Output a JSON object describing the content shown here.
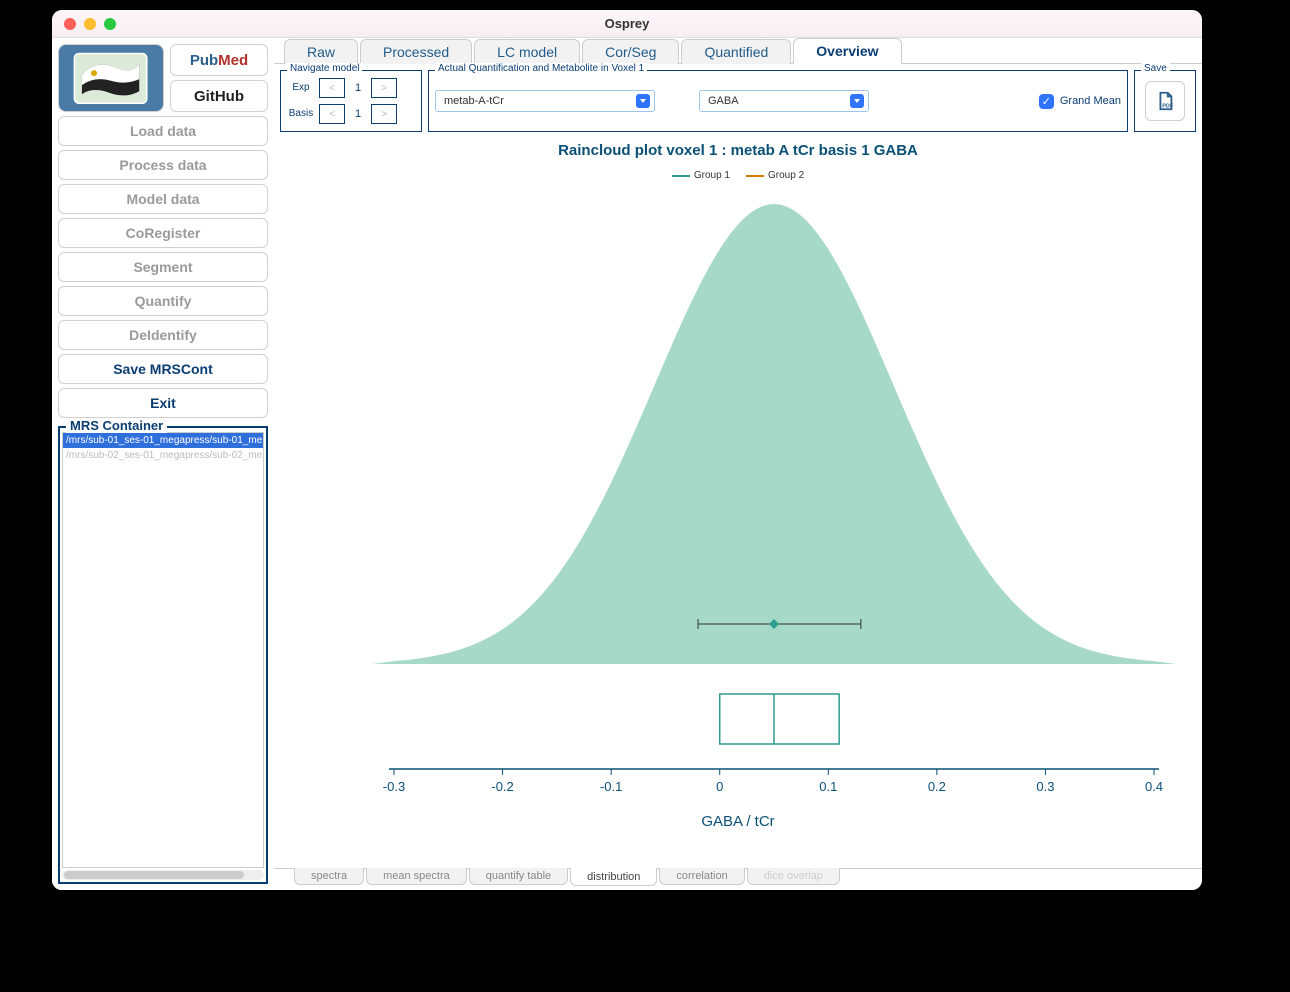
{
  "window": {
    "title": "Osprey"
  },
  "links": {
    "pubmed": "PubMed",
    "github": "GitHub"
  },
  "sidebar": {
    "buttons": [
      "Load data",
      "Process data",
      "Model data",
      "CoRegister",
      "Segment",
      "Quantify",
      "DeIdentify",
      "Save MRSCont",
      "Exit"
    ],
    "container_title": "MRS Container",
    "items": [
      "/mrs/sub-01_ses-01_megapress/sub-01_me...",
      "/mrs/sub-02_ses-01_megapress/sub-02_me..."
    ],
    "selected_index": 0
  },
  "tabs_top": [
    "Raw",
    "Processed",
    "LC model",
    "Cor/Seg",
    "Quantified",
    "Overview"
  ],
  "tabs_top_active": 5,
  "nav_model": {
    "legend": "Navigate model",
    "rows": [
      {
        "label": "Exp",
        "value": "1"
      },
      {
        "label": "Basis",
        "value": "1"
      }
    ],
    "prev": "<",
    "next": ">"
  },
  "quant": {
    "legend": "Actual Quantification and Metabolite in Voxel 1",
    "select1": "metab-A-tCr",
    "select2": "GABA",
    "check_label": "Grand Mean",
    "checked": true
  },
  "save": {
    "legend": "Save",
    "pdf": "PDF"
  },
  "plot": {
    "title": "Raincloud plot voxel 1 : metab A tCr basis 1 GABA",
    "legend": [
      "Group 1",
      "Group 2"
    ],
    "xlabel": "GABA / tCr"
  },
  "chart_data": {
    "type": "raincloud",
    "xlabel": "GABA / tCr",
    "x_ticks": [
      -0.3,
      -0.2,
      -0.1,
      0,
      0.1,
      0.2,
      0.3,
      0.4
    ],
    "xlim": [
      -0.3,
      0.4
    ],
    "series": [
      {
        "name": "Group 1",
        "color": "#2d9c8d"
      },
      {
        "name": "Group 2",
        "color": "#d57a00"
      }
    ],
    "density_fill": "#a6d9c7",
    "density_peak_x": 0.05,
    "mean_marker_x": 0.05,
    "err_bar_range": [
      -0.02,
      0.13
    ],
    "box": {
      "q1": 0.0,
      "median": 0.05,
      "q3": 0.11
    }
  },
  "tabs_bottom": [
    "spectra",
    "mean spectra",
    "quantify table",
    "distribution",
    "correlation",
    "dice overlap"
  ],
  "tabs_bottom_active": 3,
  "tabs_bottom_disabled": [
    5
  ]
}
